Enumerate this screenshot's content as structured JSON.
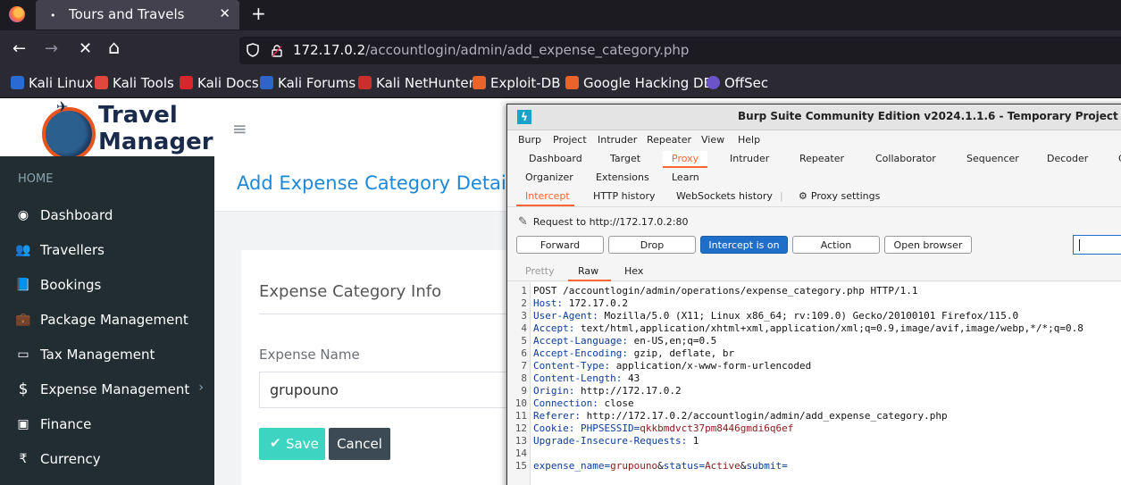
{
  "browser": {
    "tab_title": "Tours and Travels",
    "tab_dot": "•",
    "tab_close": "✕",
    "new_tab": "+",
    "url_host": "172.17.0.2",
    "url_path": "/accountlogin/admin/add_expense_category.php",
    "nav": {
      "back": "←",
      "forward": "→",
      "stop": "✕",
      "home": "⌂"
    },
    "bookmarks": [
      {
        "label": "Kali Linux",
        "color": "#2a6bd1"
      },
      {
        "label": "Kali Tools",
        "color": "#e0483e"
      },
      {
        "label": "Kali Docs",
        "color": "#d8262d"
      },
      {
        "label": "Kali Forums",
        "color": "#2d66c8"
      },
      {
        "label": "Kali NetHunter",
        "color": "#c9302c"
      },
      {
        "label": "Exploit-DB",
        "color": "#e8642b"
      },
      {
        "label": "Google Hacking DB",
        "color": "#e8642b"
      },
      {
        "label": "OffSec",
        "color": "#6b54c9"
      }
    ]
  },
  "site": {
    "logo_line1": "Travel",
    "logo_line2": "Manager",
    "menu_toggle": "≡",
    "sidebar": {
      "header": "HOME",
      "items": [
        {
          "label": "Dashboard",
          "icon": "dashboard-icon",
          "glyph": "◉"
        },
        {
          "label": "Travellers",
          "icon": "users-icon",
          "glyph": "👥"
        },
        {
          "label": "Bookings",
          "icon": "book-icon",
          "glyph": "📘"
        },
        {
          "label": "Package Management",
          "icon": "briefcase-icon",
          "glyph": "💼"
        },
        {
          "label": "Tax Management",
          "icon": "card-icon",
          "glyph": "▭"
        },
        {
          "label": "Expense Management",
          "icon": "dollar-icon",
          "glyph": "$"
        },
        {
          "label": "Finance",
          "icon": "money-icon",
          "glyph": "▣"
        },
        {
          "label": "Currency",
          "icon": "rupee-icon",
          "glyph": "₹"
        }
      ],
      "expense_caret": "›"
    },
    "page_title": "Add Expense Category Details",
    "card_title": "Expense Category Info",
    "field_label": "Expense Name",
    "field_value": "grupouno",
    "save_check": "✔",
    "save_label": "Save",
    "cancel_label": "Cancel"
  },
  "burp": {
    "title": "Burp Suite Community Edition v2024.1.1.6 - Temporary Project",
    "logo_glyph": "ϟ",
    "menu": [
      "Burp",
      "Project",
      "Intruder",
      "Repeater",
      "View",
      "Help"
    ],
    "tabs_row1": [
      "Dashboard",
      "Target",
      "Proxy",
      "Intruder",
      "Repeater",
      "Collaborator",
      "Sequencer",
      "Decoder",
      "C"
    ],
    "tabs_row2": [
      "Organizer",
      "Extensions",
      "Learn"
    ],
    "active_tab": "Proxy",
    "subtabs": [
      "Intercept",
      "HTTP history",
      "WebSockets history"
    ],
    "proxy_settings": "Proxy settings",
    "request_line": "Request to http://172.17.0.2:80",
    "buttons": [
      "Forward",
      "Drop",
      "Intercept is on",
      "Action",
      "Open browser"
    ],
    "view_tabs": [
      "Pretty",
      "Raw",
      "Hex"
    ],
    "request": [
      {
        "n": "1",
        "text": "POST /accountlogin/admin/operations/expense_category.php HTTP/1.1"
      },
      {
        "n": "2",
        "key": "Host",
        "val": " 172.17.0.2"
      },
      {
        "n": "3",
        "key": "User-Agent",
        "val": " Mozilla/5.0 (X11; Linux x86_64; rv:109.0) Gecko/20100101 Firefox/115.0"
      },
      {
        "n": "4",
        "key": "Accept",
        "val": " text/html,application/xhtml+xml,application/xml;q=0.9,image/avif,image/webp,*/*;q=0.8"
      },
      {
        "n": "5",
        "key": "Accept-Language",
        "val": " en-US,en;q=0.5"
      },
      {
        "n": "6",
        "key": "Accept-Encoding",
        "val": " gzip, deflate, br"
      },
      {
        "n": "7",
        "key": "Content-Type",
        "val": " application/x-www-form-urlencoded"
      },
      {
        "n": "8",
        "key": "Content-Length",
        "val": " 43"
      },
      {
        "n": "9",
        "key": "Origin",
        "val": " http://172.17.0.2"
      },
      {
        "n": "10",
        "key": "Connection",
        "val": " close"
      },
      {
        "n": "11",
        "key": "Referer",
        "val": " http://172.17.0.2/accountlogin/admin/add_expense_category.php"
      },
      {
        "n": "12",
        "key": "Cookie",
        "val": " PHPSESSID=qkkbmdvct37pm8446gmdi6q6ef"
      },
      {
        "n": "13",
        "key": "Upgrade-Insecure-Requests",
        "val": " 1"
      },
      {
        "n": "14",
        "text": ""
      },
      {
        "n": "15",
        "body": "expense_name=grupouno&status=Active&submit="
      }
    ]
  }
}
